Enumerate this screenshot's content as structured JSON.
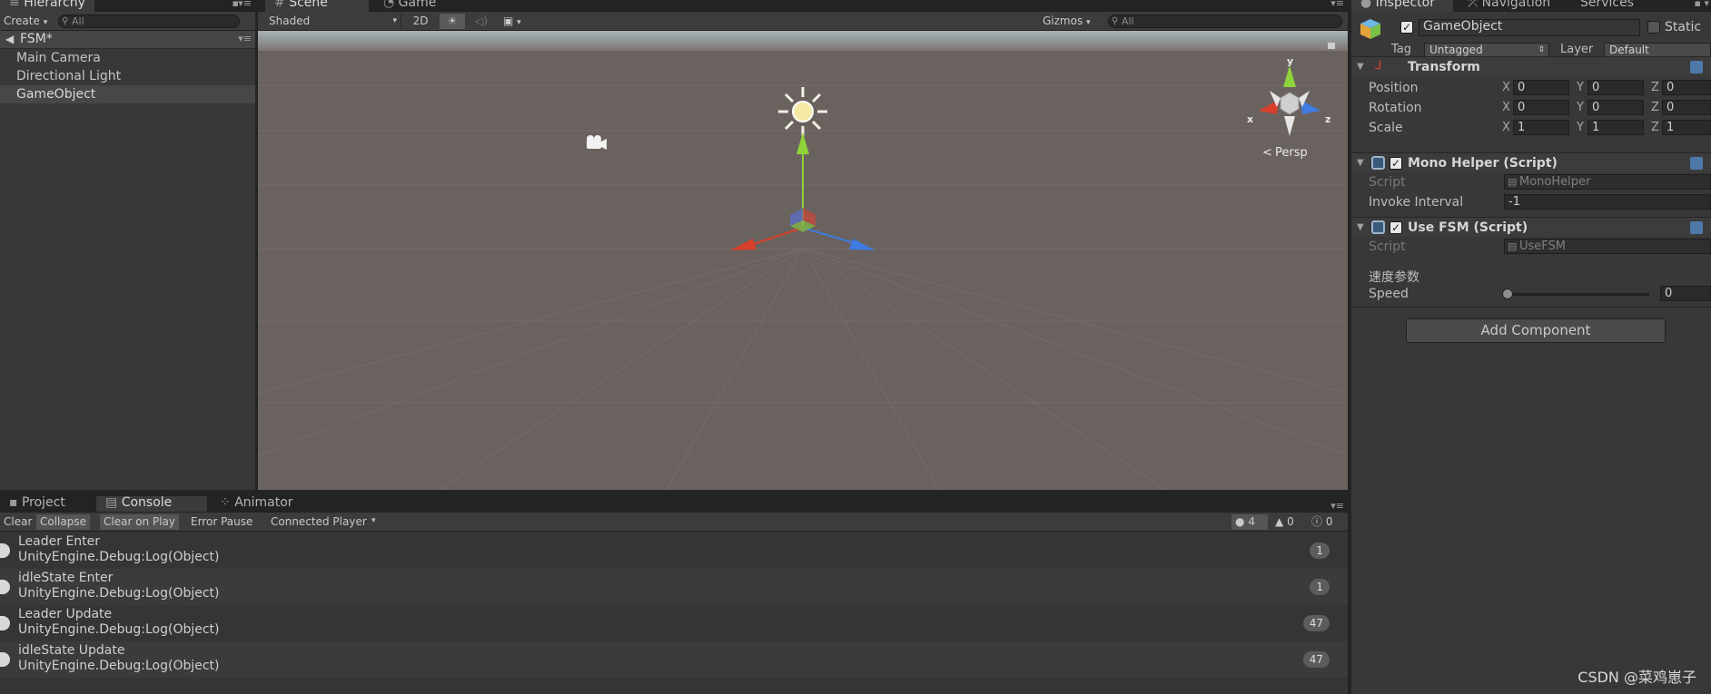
{
  "hierarchy": {
    "tab": "Hierarchy",
    "create": "Create",
    "search_placeholder": "All",
    "scene_name": "FSM*",
    "items": [
      {
        "label": "Main Camera"
      },
      {
        "label": "Directional Light"
      },
      {
        "label": "GameObject"
      }
    ]
  },
  "scene": {
    "tabs": [
      "Scene",
      "Game"
    ],
    "shading": "Shaded",
    "mode_2d": "2D",
    "gizmos": "Gizmos",
    "search_placeholder": "All",
    "projection": "Persp",
    "axes": {
      "x": "x",
      "y": "y",
      "z": "z"
    }
  },
  "console": {
    "tabs": [
      "Project",
      "Console",
      "Animator"
    ],
    "toolbar": {
      "clear": "Clear",
      "collapse": "Collapse",
      "clear_on_play": "Clear on Play",
      "error_pause": "Error Pause",
      "connected_player": "Connected Player"
    },
    "counts": {
      "info": "4",
      "warnings": "0",
      "errors": "0"
    },
    "entries": [
      {
        "message": "Leader Enter",
        "source": "UnityEngine.Debug:Log(Object)",
        "count": "1"
      },
      {
        "message": "idleState Enter",
        "source": "UnityEngine.Debug:Log(Object)",
        "count": "1"
      },
      {
        "message": "Leader Update",
        "source": "UnityEngine.Debug:Log(Object)",
        "count": "47"
      },
      {
        "message": "idleState Update",
        "source": "UnityEngine.Debug:Log(Object)",
        "count": "47"
      }
    ]
  },
  "inspector": {
    "tabs": [
      "Inspector",
      "Navigation",
      "Services"
    ],
    "object_name": "GameObject",
    "static_label": "Static",
    "tag_label": "Tag",
    "tag_value": "Untagged",
    "layer_label": "Layer",
    "layer_value": "Default",
    "transform": {
      "title": "Transform",
      "position": {
        "label": "Position",
        "x": "0",
        "y": "0",
        "z": "0"
      },
      "rotation": {
        "label": "Rotation",
        "x": "0",
        "y": "0",
        "z": "0"
      },
      "scale": {
        "label": "Scale",
        "x": "1",
        "y": "1",
        "z": "1"
      }
    },
    "mono_helper": {
      "title": "Mono Helper (Script)",
      "script_label": "Script",
      "script_value": "MonoHelper",
      "interval_label": "Invoke Interval",
      "interval_value": "-1"
    },
    "use_fsm": {
      "title": "Use FSM (Script)",
      "script_label": "Script",
      "script_value": "UseFSM",
      "header": "速度参数",
      "speed_label": "Speed",
      "speed_value": "0",
      "speed_fraction": 0
    },
    "add_component": "Add Component"
  },
  "watermark": "CSDN @菜鸡崽子",
  "colors": {
    "x_axis": "#d8402c",
    "y_axis": "#8fd33a",
    "z_axis": "#3f7be0",
    "panel_bg": "#383838",
    "scene_ground": "#6a625e"
  }
}
